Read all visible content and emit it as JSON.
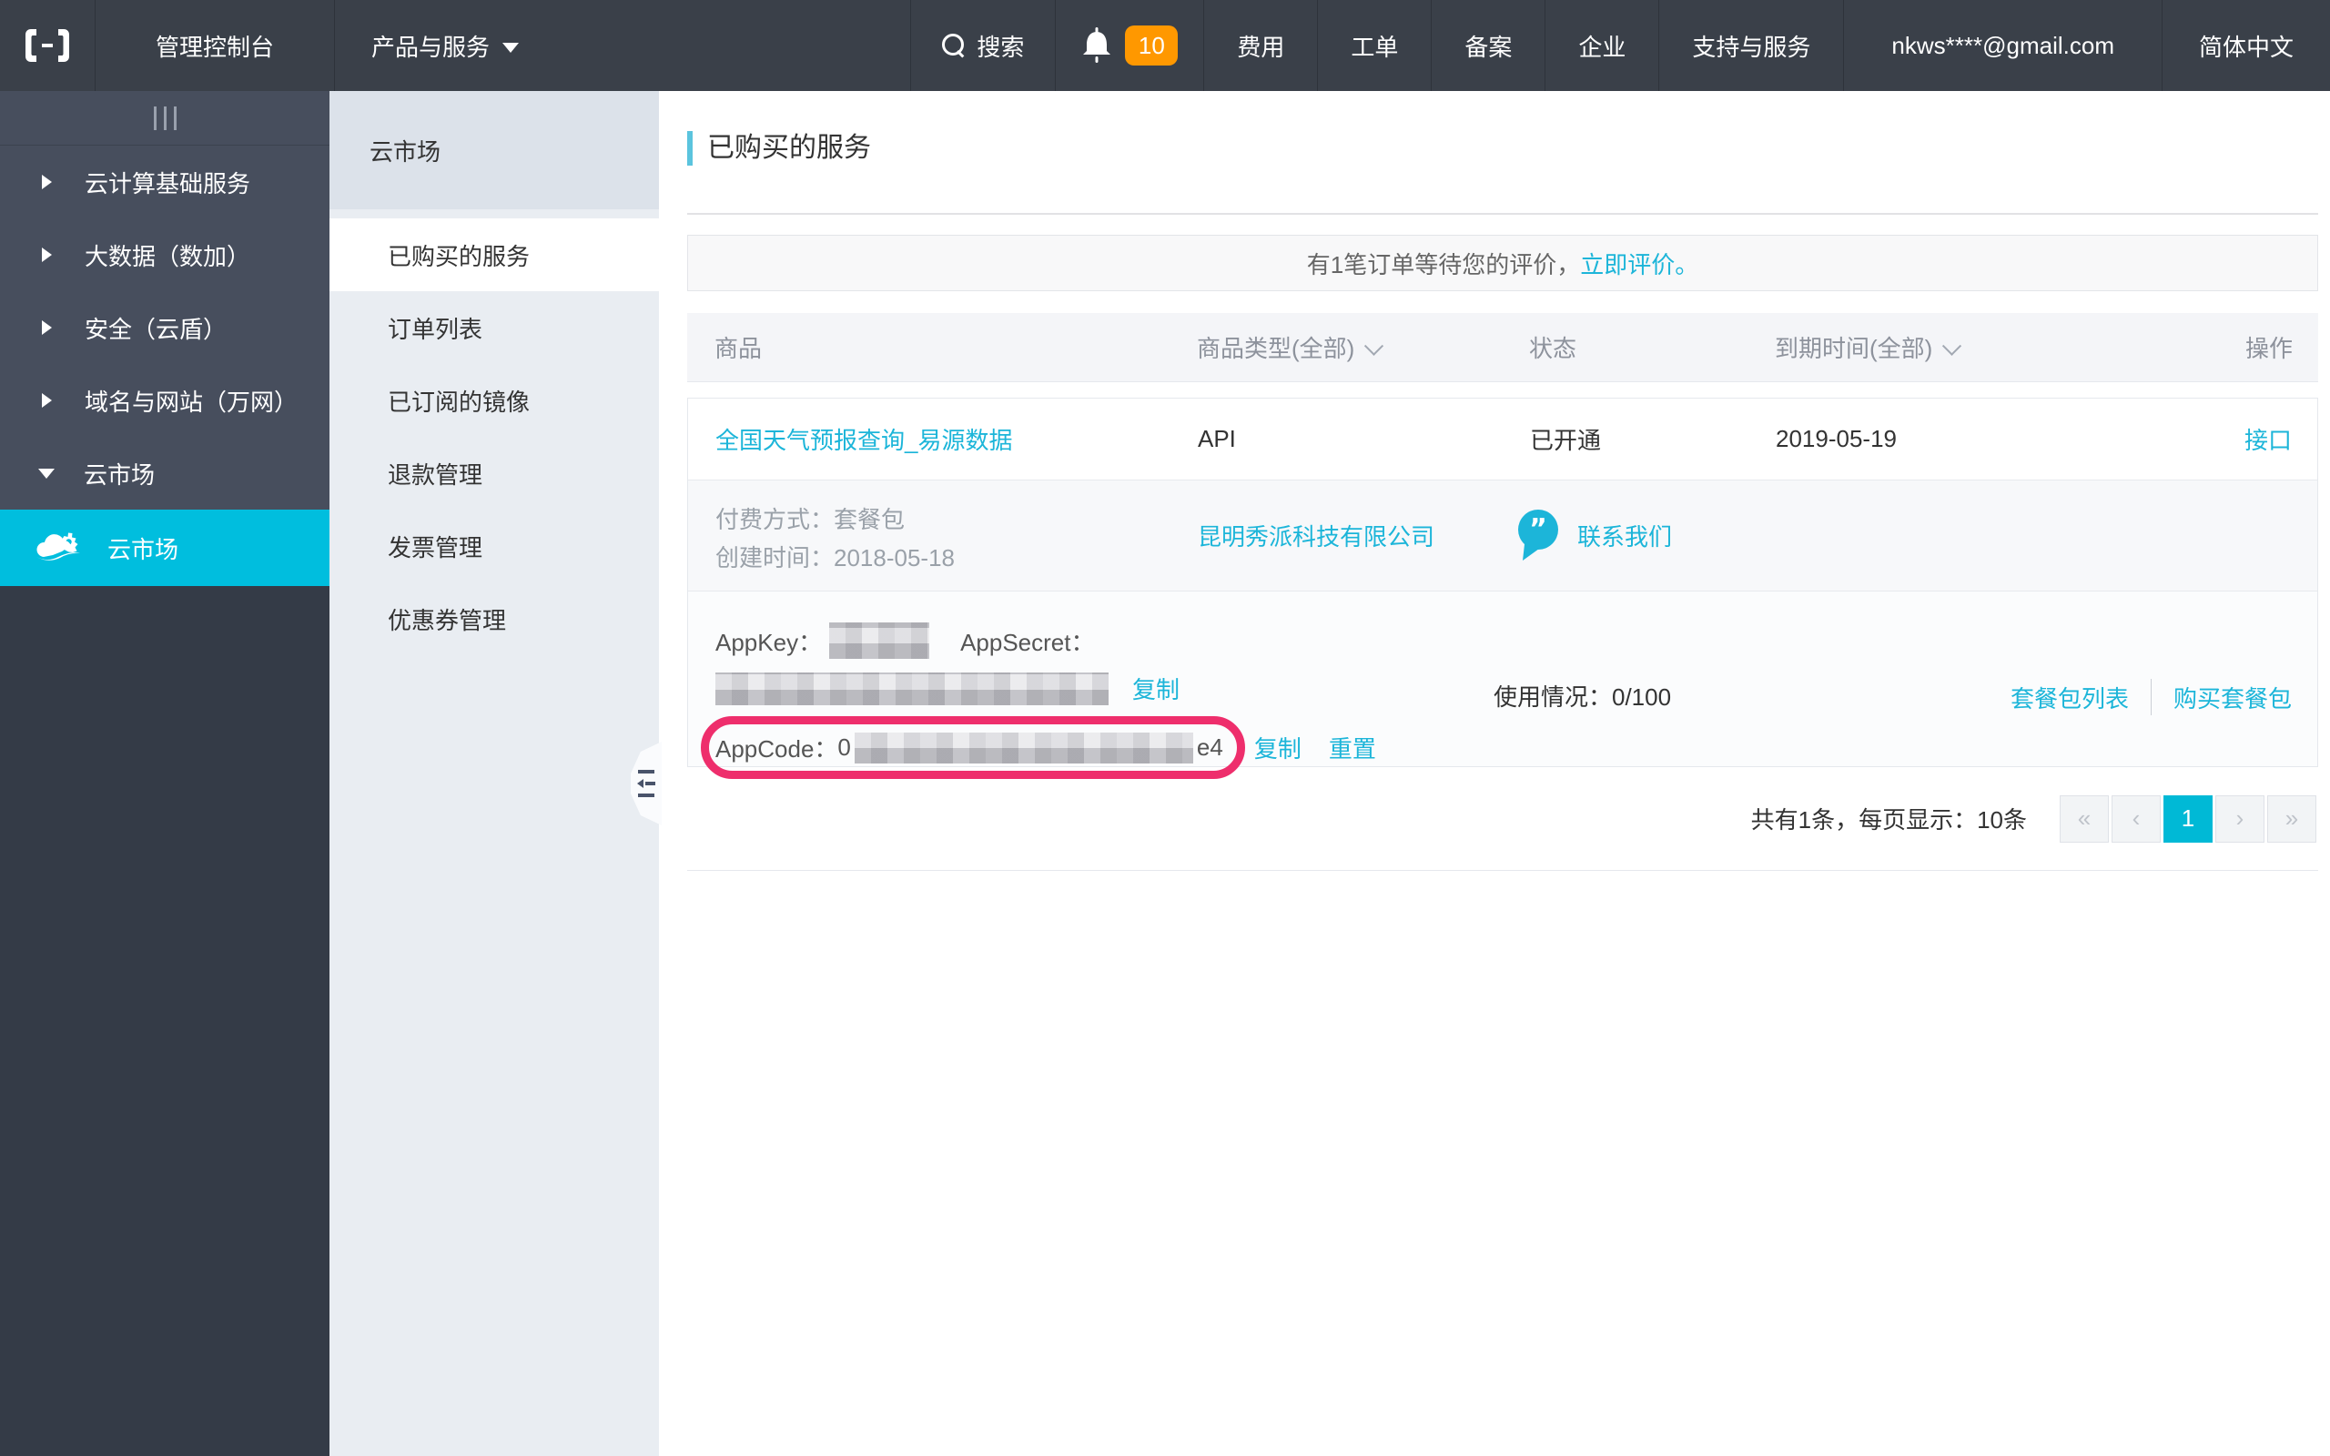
{
  "navbar": {
    "console_label": "管理控制台",
    "products_label": "产品与服务",
    "search_label": "搜索",
    "notification_count": "10",
    "items": [
      {
        "label": "费用"
      },
      {
        "label": "工单"
      },
      {
        "label": "备案"
      },
      {
        "label": "企业"
      },
      {
        "label": "支持与服务"
      }
    ],
    "account": "nkws****@gmail.com",
    "language": "简体中文"
  },
  "sidebar": {
    "items": [
      {
        "label": "云计算基础服务",
        "state": "collapsed"
      },
      {
        "label": "大数据（数加）",
        "state": "collapsed"
      },
      {
        "label": "安全（云盾）",
        "state": "collapsed"
      },
      {
        "label": "域名与网站（万网）",
        "state": "collapsed"
      },
      {
        "label": "云市场",
        "state": "expanded"
      }
    ],
    "active_item": "云市场"
  },
  "submenu": {
    "title": "云市场",
    "items": [
      {
        "label": "已购买的服务",
        "active": true
      },
      {
        "label": "订单列表",
        "active": false
      },
      {
        "label": "已订阅的镜像",
        "active": false
      },
      {
        "label": "退款管理",
        "active": false
      },
      {
        "label": "发票管理",
        "active": false
      },
      {
        "label": "优惠券管理",
        "active": false
      }
    ]
  },
  "main": {
    "title": "已购买的服务",
    "notice": {
      "text": "有1笔订单等待您的评价，",
      "link": "立即评价。"
    },
    "table": {
      "headers": {
        "product": "商品",
        "type": "商品类型(全部)",
        "status": "状态",
        "expire": "到期时间(全部)",
        "action": "操作"
      },
      "row": {
        "product": "全国天气预报查询_易源数据",
        "type": "API",
        "status": "已开通",
        "expire": "2019-05-19",
        "action": "接口",
        "pay_method": "付费方式：套餐包",
        "created": "创建时间：2018-05-18",
        "vendor": "昆明秀派科技有限公司",
        "contact": "联系我们",
        "appkey_label": "AppKey：",
        "appsecret_label": "AppSecret：",
        "copy_label": "复制",
        "appcode_label": "AppCode：",
        "appcode_prefix": "0",
        "appcode_suffix": "e4",
        "reset_label": "重置",
        "usage": "使用情况：0/100",
        "package_list": "套餐包列表",
        "buy_package": "购买套餐包"
      }
    },
    "footer": {
      "summary": "共有1条，每页显示：10条",
      "pagination": {
        "first": "«",
        "prev": "‹",
        "page": "1",
        "next": "›",
        "last": "»"
      }
    }
  },
  "colors": {
    "brand_cyan": "#00bede",
    "link_cyan": "#1cb5d9",
    "badge_orange": "#ff9800",
    "highlight_pink": "#ee2e6c",
    "navbar_bg": "#3a4049",
    "sidebar_bg": "#474e5d"
  }
}
